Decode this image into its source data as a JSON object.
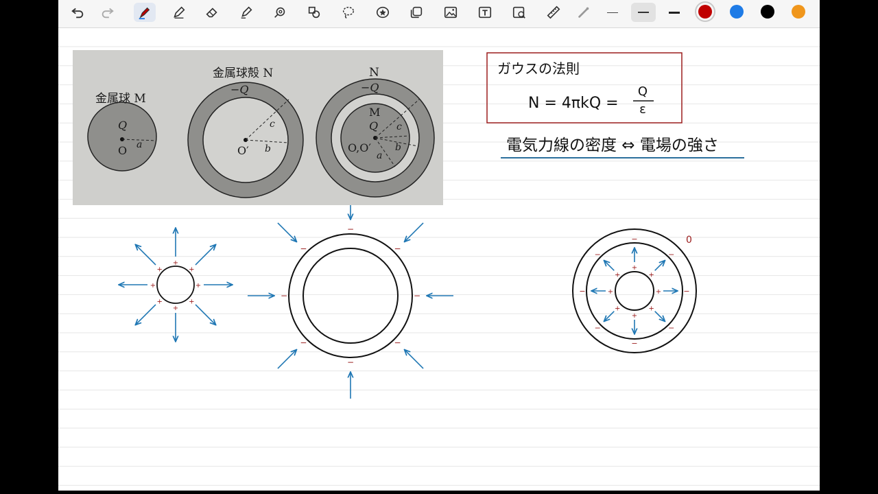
{
  "toolbar": {
    "tools": [
      {
        "name": "undo-icon"
      },
      {
        "name": "redo-icon"
      },
      {
        "name": "bluetooth-pen-icon"
      },
      {
        "name": "pen-icon"
      },
      {
        "name": "eraser-icon"
      },
      {
        "name": "highlighter-icon"
      },
      {
        "name": "shape-tool-icon"
      },
      {
        "name": "element-tool-icon"
      },
      {
        "name": "lasso-icon"
      },
      {
        "name": "sticker-icon"
      },
      {
        "name": "copy-icon"
      },
      {
        "name": "image-icon"
      },
      {
        "name": "text-icon"
      },
      {
        "name": "camera-icon"
      },
      {
        "name": "ruler-icon"
      },
      {
        "name": "laser-icon"
      }
    ],
    "colors": [
      "#c00000",
      "#1e7be6",
      "#000000",
      "#f0961c"
    ]
  },
  "textbook": {
    "m_title": "金属球 M",
    "n_title": "金属球殻 N",
    "n_title_2": "N",
    "minus_q": "−Q",
    "minus_q_2": "−Q",
    "q": "Q",
    "q_2": "Q",
    "o": "O",
    "o_prime": "O′",
    "o_double": "O,O′",
    "m_label": "M",
    "a": "a",
    "a_2": "a",
    "b": "b",
    "b_2": "b",
    "c": "c",
    "c_2": "c"
  },
  "notes": {
    "gauss_title": "ガウスの法則",
    "gauss_formula": "N = 4πkQ =",
    "gauss_num": "Q",
    "gauss_den": "ε",
    "density_line": "電気力線の密度 ⇔ 電場の強さ",
    "zero_mark": "0"
  },
  "accent": {
    "red": "#9b1c1c",
    "blue": "#1f77b4",
    "ink": "#111111"
  }
}
